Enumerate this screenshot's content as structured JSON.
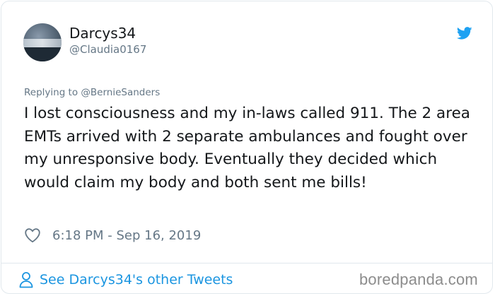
{
  "author": {
    "display_name": "Darcys34",
    "handle": "@Claudia0167",
    "avatar_icon": "profile-photo"
  },
  "brand_icon": "twitter-bird-icon",
  "brand_color": "#1da1f2",
  "tweet": {
    "replying_to": "Replying to @BernieSanders",
    "text": "I lost consciousness and my in-laws called 911. The 2 area EMTs arrived with 2 separate ambulances and fought over my unresponsive body. Eventually they decided which would claim my body and both sent me bills!",
    "timestamp": "6:18 PM - Sep 16, 2019",
    "like_icon": "heart-icon"
  },
  "footer": {
    "link_label": "See Darcys34's other Tweets",
    "link_icon": "person-icon",
    "link_color": "#1b95e0",
    "watermark": "boredpanda.com"
  }
}
